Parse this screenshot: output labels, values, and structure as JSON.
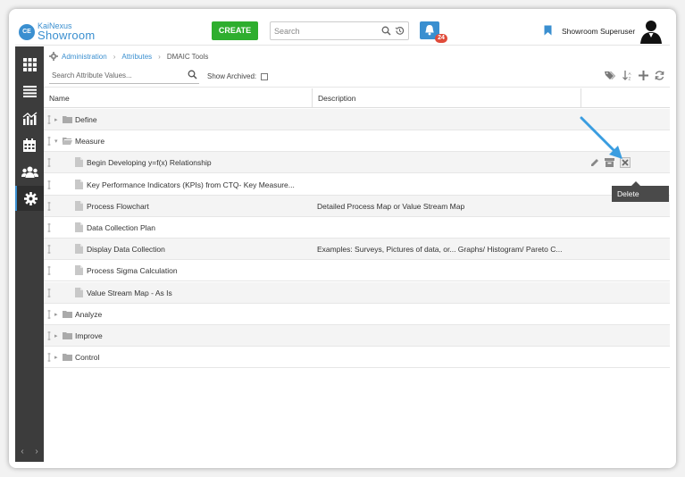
{
  "header": {
    "logo_small": "KaiNexus",
    "logo_big": "Showroom",
    "logo_initials": "CE",
    "create_label": "CREATE",
    "search_placeholder": "Search",
    "notification_count": "24",
    "user_name": "Showroom Superuser"
  },
  "breadcrumb": {
    "items": [
      "Administration",
      "Attributes",
      "DMAIC Tools"
    ]
  },
  "toolbar": {
    "search_placeholder": "Search Attribute Values...",
    "show_archived_label": "Show Archived:",
    "show_archived_checked": false
  },
  "table": {
    "columns": [
      "Name",
      "Description"
    ],
    "rows": [
      {
        "name": "Define",
        "description": "",
        "type": "folder",
        "expanded": false
      },
      {
        "name": "Measure",
        "description": "",
        "type": "folder",
        "expanded": true
      },
      {
        "name": "Begin Developing y=f(x) Relationship",
        "description": "",
        "type": "item"
      },
      {
        "name": "Key Performance Indicators (KPIs) from CTQ- Key Measure...",
        "description": "",
        "type": "item"
      },
      {
        "name": "Process Flowchart",
        "description": "Detailed Process Map or Value Stream Map",
        "type": "item"
      },
      {
        "name": "Data Collection Plan",
        "description": "",
        "type": "item"
      },
      {
        "name": "Display Data Collection",
        "description": "Examples: Surveys, Pictures of data, or... Graphs/ Histogram/ Pareto C...",
        "type": "item"
      },
      {
        "name": "Process Sigma Calculation",
        "description": "",
        "type": "item"
      },
      {
        "name": "Value Stream Map - As Is",
        "description": "",
        "type": "item"
      },
      {
        "name": "Analyze",
        "description": "",
        "type": "folder",
        "expanded": false
      },
      {
        "name": "Improve",
        "description": "",
        "type": "folder",
        "expanded": false
      },
      {
        "name": "Control",
        "description": "",
        "type": "folder",
        "expanded": false
      }
    ]
  },
  "tooltip": {
    "label": "Delete"
  },
  "colors": {
    "accent": "#3a8fd0",
    "create": "#2eae2e",
    "badge": "#e04b3a",
    "sidebar": "#3c3c3c"
  }
}
